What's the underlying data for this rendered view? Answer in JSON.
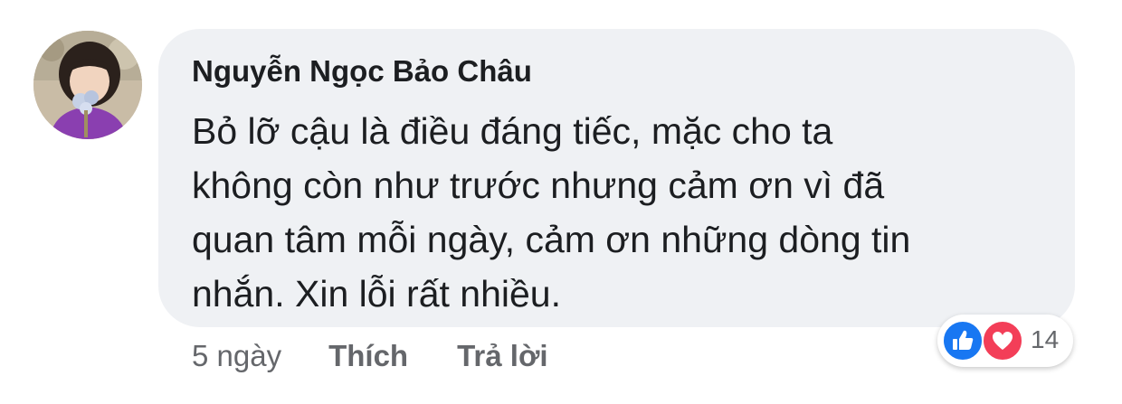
{
  "comment": {
    "author": "Nguyễn Ngọc Bảo Châu",
    "text_lines": [
      "Bỏ lỡ cậu là điều đáng tiếc, mặc cho ta",
      "không còn như trước nhưng cảm ơn vì đã",
      "quan tâm mỗi ngày, cảm ơn những dòng tin",
      "nhắn. Xin lỗi rất nhiều."
    ],
    "timestamp": "5 ngày",
    "like_label": "Thích",
    "reply_label": "Trả lời",
    "reactions": {
      "icons": [
        "thumbs-up-icon",
        "heart-icon"
      ],
      "count": "14"
    }
  },
  "colors": {
    "bubble": "#eff1f4",
    "text": "#1c1e21",
    "meta": "#65676b",
    "like": "#1877f2",
    "love": "#f33e58"
  }
}
